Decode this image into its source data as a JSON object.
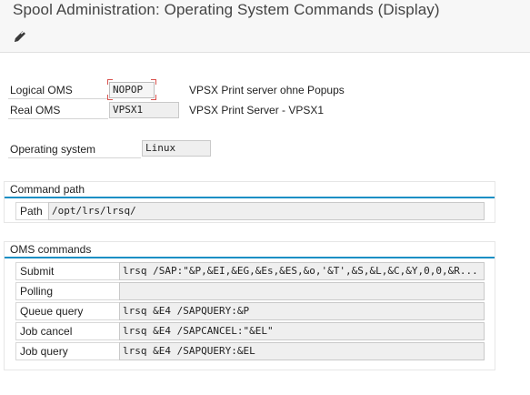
{
  "title": "Spool Administration: Operating System Commands (Display)",
  "toolbar": {
    "edit_icon": "pencil-icon"
  },
  "oms": {
    "logical_label": "Logical OMS",
    "logical_value": "NOPOP",
    "logical_desc": "VPSX Print server ohne Popups",
    "real_label": "Real OMS",
    "real_value": "VPSX1",
    "real_desc": "VPSX Print Server - VPSX1"
  },
  "os": {
    "label": "Operating system",
    "value": "Linux"
  },
  "command_path": {
    "header": "Command path",
    "path_label": "Path",
    "path_value": "/opt/lrs/lrsq/"
  },
  "oms_commands": {
    "header": "OMS commands",
    "rows": [
      {
        "label": "Submit",
        "value": "lrsq /SAP:\"&P,&EI,&EG,&Es,&ES,&o,'&T',&S,&L,&C,&Y,0,0,&R..."
      },
      {
        "label": "Polling",
        "value": ""
      },
      {
        "label": "Queue query",
        "value": "lrsq &E4 /SAPQUERY:&P"
      },
      {
        "label": "Job cancel",
        "value": "lrsq &E4 /SAPCANCEL:\"&EL\""
      },
      {
        "label": "Job query",
        "value": "lrsq &E4 /SAPQUERY:&EL"
      }
    ]
  },
  "colors": {
    "accent": "#1a8fc4",
    "focus_corner": "#d9534f"
  }
}
